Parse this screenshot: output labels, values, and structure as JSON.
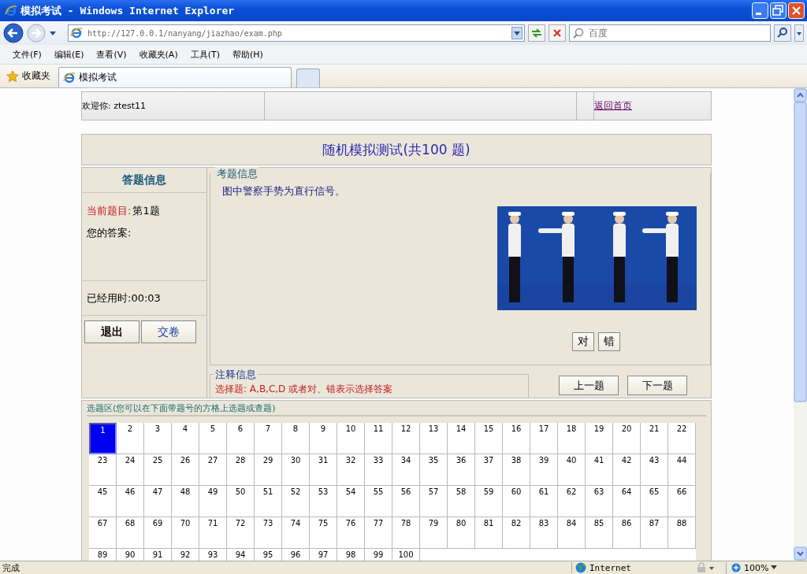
{
  "window": {
    "title": "模拟考试 - Windows Internet Explorer"
  },
  "address_bar": {
    "url": "http://127.0.0.1/nanyang/jiazhao/exam.php"
  },
  "search": {
    "placeholder": "百度"
  },
  "menu": [
    "文件(F)",
    "编辑(E)",
    "查看(V)",
    "收藏夹(A)",
    "工具(T)",
    "帮助(H)"
  ],
  "favorites": {
    "label": "收藏夹"
  },
  "tabs": [
    {
      "label": "模拟考试",
      "selected": true
    }
  ],
  "page": {
    "welcome": "欢迎你: ztest11",
    "home_link": "返回首页",
    "heading": "随机模拟测试(共100 题)",
    "answer_panel": {
      "title": "答题信息",
      "current_label": "当前题目:",
      "current_value": "第1题",
      "answer_label": "您的答案:",
      "elapsed": "已经用时:00:03",
      "buttons": [
        "退出",
        "交卷"
      ]
    },
    "question_panel": {
      "title": "考题信息",
      "question": "图中警察手势为直行信号。",
      "answer_buttons": [
        "对",
        "错"
      ]
    },
    "notes": {
      "title": "注释信息",
      "text": "选择题: A,B,C,D 或者对、错表示选择答案"
    },
    "nav_buttons": [
      "上一题",
      "下一题"
    ],
    "selection": {
      "title": "选题区(您可以在下面带题号的方格上选题或查题)",
      "questions": [
        {
          "label": "1",
          "selected": true
        },
        {
          "label": "2",
          "selected": false
        },
        {
          "label": "3",
          "selected": false
        },
        {
          "label": "4",
          "selected": false
        },
        {
          "label": "5",
          "selected": false
        },
        {
          "label": "6",
          "selected": false
        },
        {
          "label": "7",
          "selected": false
        },
        {
          "label": "8",
          "selected": false
        },
        {
          "label": "9",
          "selected": false
        },
        {
          "label": "10",
          "selected": false
        },
        {
          "label": "11",
          "selected": false
        },
        {
          "label": "12",
          "selected": false
        },
        {
          "label": "13",
          "selected": false
        },
        {
          "label": "14",
          "selected": false
        },
        {
          "label": "15",
          "selected": false
        },
        {
          "label": "16",
          "selected": false
        },
        {
          "label": "17",
          "selected": false
        },
        {
          "label": "18",
          "selected": false
        },
        {
          "label": "19",
          "selected": false
        },
        {
          "label": "20",
          "selected": false
        },
        {
          "label": "21",
          "selected": false
        },
        {
          "label": "22",
          "selected": false
        },
        {
          "label": "23",
          "selected": false
        },
        {
          "label": "24",
          "selected": false
        },
        {
          "label": "25",
          "selected": false
        },
        {
          "label": "26",
          "selected": false
        },
        {
          "label": "27",
          "selected": false
        },
        {
          "label": "28",
          "selected": false
        },
        {
          "label": "29",
          "selected": false
        },
        {
          "label": "30",
          "selected": false
        },
        {
          "label": "31",
          "selected": false
        },
        {
          "label": "32",
          "selected": false
        },
        {
          "label": "33",
          "selected": false
        },
        {
          "label": "34",
          "selected": false
        },
        {
          "label": "35",
          "selected": false
        },
        {
          "label": "36",
          "selected": false
        },
        {
          "label": "37",
          "selected": false
        },
        {
          "label": "38",
          "selected": false
        },
        {
          "label": "39",
          "selected": false
        },
        {
          "label": "40",
          "selected": false
        },
        {
          "label": "41",
          "selected": false
        },
        {
          "label": "42",
          "selected": false
        },
        {
          "label": "43",
          "selected": false
        },
        {
          "label": "44",
          "selected": false
        },
        {
          "label": "45",
          "selected": false
        },
        {
          "label": "46",
          "selected": false
        },
        {
          "label": "47",
          "selected": false
        },
        {
          "label": "48",
          "selected": false
        },
        {
          "label": "49",
          "selected": false
        },
        {
          "label": "50",
          "selected": false
        },
        {
          "label": "51",
          "selected": false
        },
        {
          "label": "52",
          "selected": false
        },
        {
          "label": "53",
          "selected": false
        },
        {
          "label": "54",
          "selected": false
        },
        {
          "label": "55",
          "selected": false
        },
        {
          "label": "56",
          "selected": false
        },
        {
          "label": "57",
          "selected": false
        },
        {
          "label": "58",
          "selected": false
        },
        {
          "label": "59",
          "selected": false
        },
        {
          "label": "60",
          "selected": false
        },
        {
          "label": "61",
          "selected": false
        },
        {
          "label": "62",
          "selected": false
        },
        {
          "label": "63",
          "selected": false
        },
        {
          "label": "64",
          "selected": false
        },
        {
          "label": "65",
          "selected": false
        },
        {
          "label": "66",
          "selected": false
        },
        {
          "label": "67",
          "selected": false
        },
        {
          "label": "68",
          "selected": false
        },
        {
          "label": "69",
          "selected": false
        },
        {
          "label": "70",
          "selected": false
        },
        {
          "label": "71",
          "selected": false
        },
        {
          "label": "72",
          "selected": false
        },
        {
          "label": "73",
          "selected": false
        },
        {
          "label": "74",
          "selected": false
        },
        {
          "label": "75",
          "selected": false
        },
        {
          "label": "76",
          "selected": false
        },
        {
          "label": "77",
          "selected": false
        },
        {
          "label": "78",
          "selected": false
        },
        {
          "label": "79",
          "selected": false
        },
        {
          "label": "80",
          "selected": false
        },
        {
          "label": "81",
          "selected": false
        },
        {
          "label": "82",
          "selected": false
        },
        {
          "label": "83",
          "selected": false
        },
        {
          "label": "84",
          "selected": false
        },
        {
          "label": "85",
          "selected": false
        },
        {
          "label": "86",
          "selected": false
        },
        {
          "label": "87",
          "selected": false
        },
        {
          "label": "88",
          "selected": false
        },
        {
          "label": "89",
          "selected": false
        },
        {
          "label": "90",
          "selected": false
        },
        {
          "label": "91",
          "selected": false
        },
        {
          "label": "92",
          "selected": false
        },
        {
          "label": "93",
          "selected": false
        },
        {
          "label": "94",
          "selected": false
        },
        {
          "label": "95",
          "selected": false
        },
        {
          "label": "96",
          "selected": false
        },
        {
          "label": "97",
          "selected": false
        },
        {
          "label": "98",
          "selected": false
        },
        {
          "label": "99",
          "selected": false
        },
        {
          "label": "100",
          "selected": false
        }
      ]
    }
  },
  "status_bar": {
    "text": "完成",
    "zone": "Internet",
    "zoom": "100%"
  }
}
